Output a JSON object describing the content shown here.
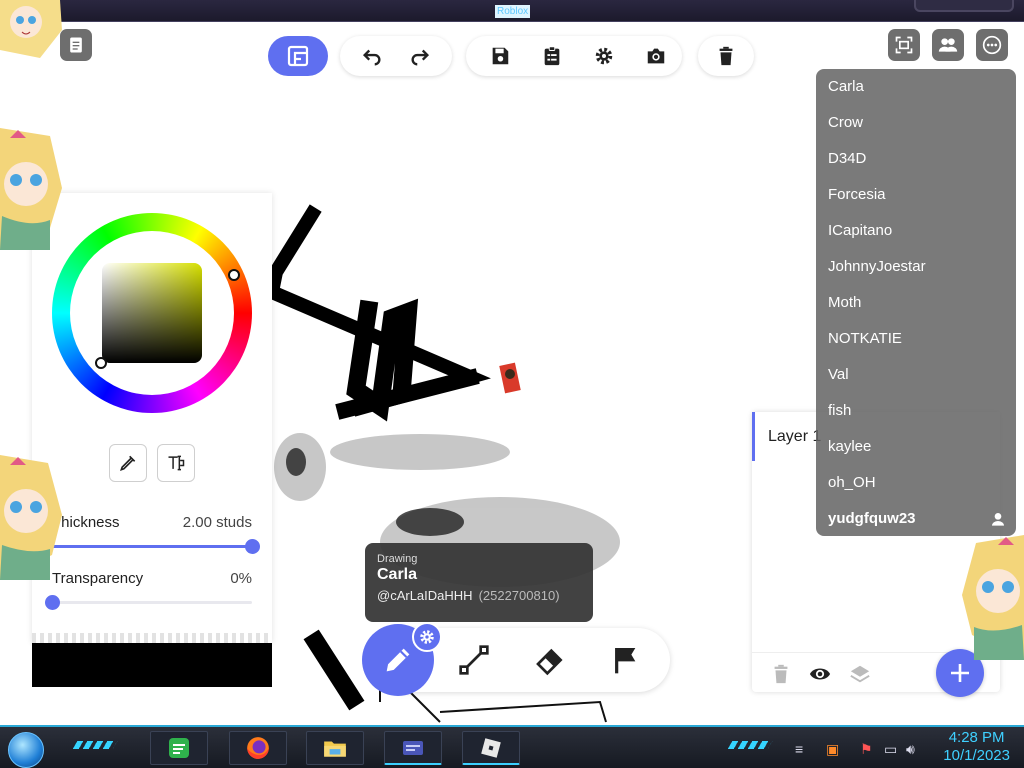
{
  "window": {
    "title": "Roblox"
  },
  "toolbar": {
    "groups": [
      {
        "items": [
          "undo-icon",
          "redo-icon"
        ]
      },
      {
        "items": [
          "save-icon",
          "clipboard-icon",
          "gear-icon",
          "camera-icon"
        ]
      },
      {
        "items": [
          "trash-icon"
        ]
      }
    ],
    "active_tool": "canvas-fit-icon",
    "right_icons": [
      "fullscreen-icon",
      "players-icon",
      "more-icon"
    ]
  },
  "color_panel": {
    "selected_color": "#000000",
    "hue_color": "#d7e000",
    "tools": [
      "eyedropper-icon",
      "text-icon"
    ],
    "thickness": {
      "label": "Thickness",
      "value": "2.00 studs",
      "fraction": 1.0
    },
    "transparency": {
      "label": "Transparency",
      "value": "0%",
      "fraction": 0.0
    }
  },
  "players": {
    "list": [
      "Carla",
      "Crow",
      "D34D",
      "Forcesia",
      "ICapitano",
      "JohnnyJoestar",
      "Moth",
      "NOTKATIE",
      "Val",
      "fish",
      "kaylee",
      "oh_OH"
    ],
    "self": "yudgfquw23"
  },
  "layers": {
    "items": [
      {
        "label": "Layer 1"
      }
    ],
    "bottom_icons": [
      "trash-icon",
      "eye-icon",
      "layers-icon"
    ]
  },
  "tooltip": {
    "status": "Drawing",
    "name": "Carla",
    "handle": "@cArLaIDaHHH",
    "user_id": "(2522700810)"
  },
  "bottom_tools": {
    "active": "pencil-icon",
    "items": [
      "pencil-icon",
      "line-icon",
      "eraser-icon",
      "flag-icon"
    ]
  },
  "taskbar": {
    "time": "4:28 PM",
    "date": "10/1/2023",
    "apps": [
      "sticky-notes",
      "firefox",
      "file-explorer",
      "media-app",
      "roblox"
    ]
  },
  "colors": {
    "accent": "#5f6ff0",
    "player_list_bg": "#646464",
    "taskbar_accent": "#3fd0ff"
  }
}
